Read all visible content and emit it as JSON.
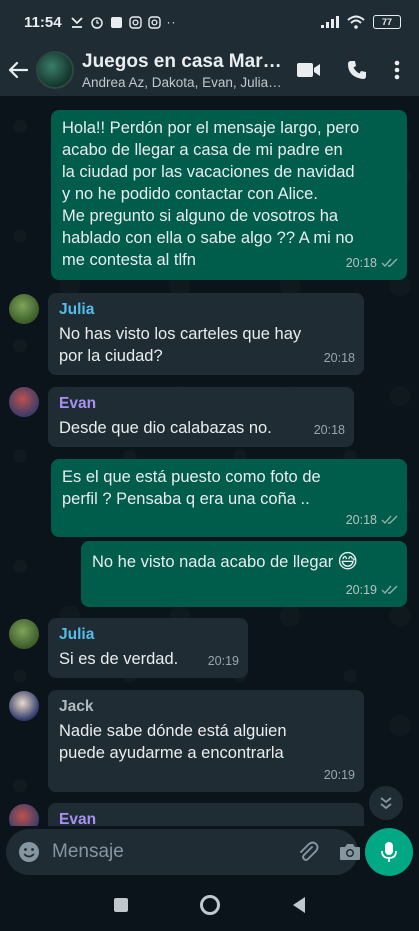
{
  "status": {
    "time": "11:54",
    "battery": "77"
  },
  "header": {
    "title": "Juegos en casa Marí…",
    "subtitle": "Andrea Az, Dakota, Evan, Julia…"
  },
  "messages": [
    {
      "type": "out",
      "text_lines": [
        "Hola!! Perdón por el mensaje largo, pero",
        "acabo de llegar a casa de mi padre en",
        "la ciudad por las vacaciones de navidad",
        "y no he podido contactar con Alice.",
        "Me pregunto si alguno de vosotros ha",
        "hablado con ella o sabe algo ?? A mi no",
        "me contesta al tlfn"
      ],
      "time": "20:18"
    },
    {
      "type": "in",
      "sender": "Julia",
      "sender_color": "#53bdeb",
      "text_lines": [
        "No has visto los carteles que hay",
        "por la ciudad?"
      ],
      "time": "20:18"
    },
    {
      "type": "in",
      "sender": "Evan",
      "sender_color": "#a791f5",
      "text_lines": [
        "Desde que dio calabazas no."
      ],
      "time": "20:18"
    },
    {
      "type": "out",
      "text_lines": [
        "Es el que está puesto como foto de",
        "perfil ? Pensaba q era una coña .."
      ],
      "time": "20:18"
    },
    {
      "type": "out",
      "text_lines": [
        "No he visto nada acabo de llegar"
      ],
      "emoji": "😅",
      "time": "20:19"
    },
    {
      "type": "in",
      "sender": "Julia",
      "sender_color": "#53bdeb",
      "text_lines": [
        "Si es de verdad."
      ],
      "time": "20:19"
    },
    {
      "type": "in",
      "sender": "Jack",
      "sender_color": "#8696a0",
      "text_lines": [
        "Nadie sabe dónde está  alguien",
        "puede ayudarme a encontrarla"
      ],
      "time": "20:19"
    },
    {
      "type": "in",
      "sender": "Evan",
      "sender_color": "#a791f5"
    }
  ],
  "input": {
    "placeholder": "Mensaje"
  },
  "colors": {
    "outgoing_bubble": "#005c4b",
    "incoming_bubble": "#202c33",
    "accent": "#00a884",
    "read_ticks": "#53bdeb"
  }
}
